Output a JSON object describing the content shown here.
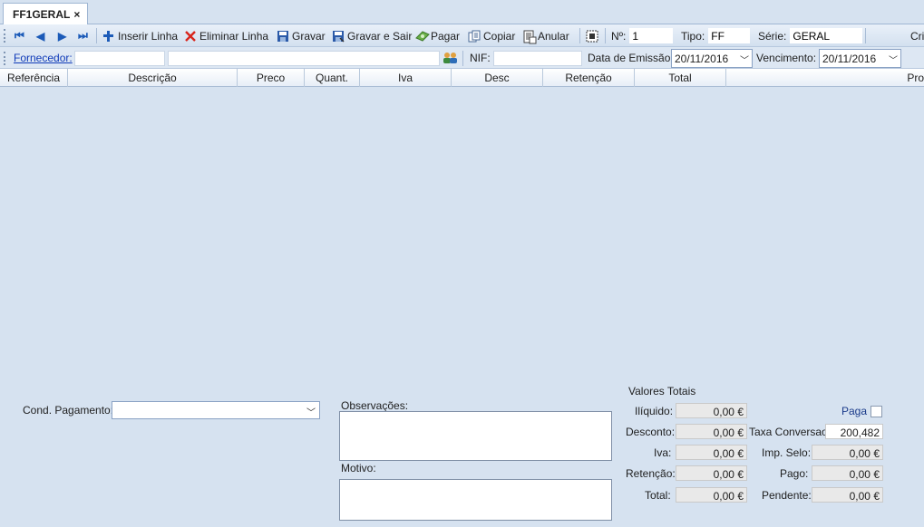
{
  "tab": {
    "label": "FF1GERAL",
    "close": "×"
  },
  "toolbar": {
    "nav": [
      "⏮",
      "◀",
      "▶",
      "⏭"
    ],
    "insert_line": "Inserir Linha",
    "delete_line": "Eliminar Linha",
    "save": "Gravar",
    "save_exit": "Gravar e Sair",
    "pay": "Pagar",
    "copy": "Copiar",
    "cancel": "Anular",
    "number_label": "Nº:",
    "number_value": "1",
    "type_label": "Tipo:",
    "type_value": "FF",
    "series_label": "Série:",
    "series_value": "GERAL",
    "cut_label": "Cri"
  },
  "filter": {
    "supplier_label": "Fornecedor:",
    "nif_label": "NIF:",
    "issue_date_label": "Data de Emissão:",
    "issue_date_value": "20/11/2016",
    "due_label": "Vencimento:",
    "due_value": "20/11/2016"
  },
  "columns": [
    "Referência",
    "Descrição",
    "Preco",
    "Quant.",
    "Iva",
    "Desc",
    "Retenção",
    "Total",
    "Pro"
  ],
  "bottom": {
    "payment_cond_label": "Cond. Pagamento:",
    "payment_cond_value": "",
    "observations_label": "Observações:",
    "reason_label": "Motivo:",
    "totals_title": "Valores Totais",
    "iliquido_label": "Ilíquido:",
    "iliquido_value": "0,00 €",
    "desconto_label": "Desconto:",
    "desconto_value": "0,00 €",
    "iva_label": "Iva:",
    "iva_value": "0,00 €",
    "retencao_label": "Retenção:",
    "retencao_value": "0,00 €",
    "total_label": "Total:",
    "total_value": "0,00 €",
    "paga_label": "Paga",
    "taxa_label": "Taxa Conversao:",
    "taxa_value": "200,482",
    "selo_label": "Imp. Selo:",
    "selo_value": "0,00 €",
    "pago_label": "Pago:",
    "pago_value": "0,00 €",
    "pendente_label": "Pendente:",
    "pendente_value": "0,00 €"
  },
  "colors": {
    "accent": "#1c5bb8",
    "link": "#0f3ab8",
    "background": "#d6e2f0"
  }
}
